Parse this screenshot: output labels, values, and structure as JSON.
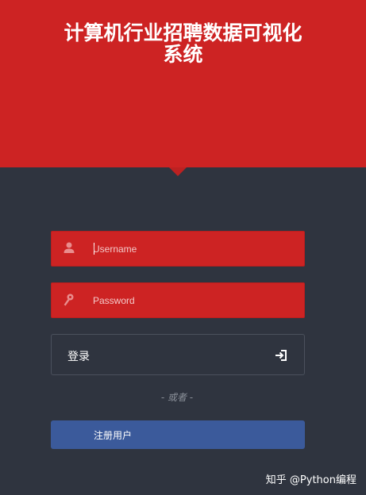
{
  "header": {
    "title_line1": "计算机行业招聘数据可视化",
    "title_line2": "系统",
    "color": "#cd2323"
  },
  "form": {
    "username": {
      "placeholder": "Username",
      "value": "",
      "icon": "user-icon"
    },
    "password": {
      "placeholder": "Password",
      "value": "",
      "icon": "key-icon"
    },
    "login_label": "登录",
    "login_icon": "sign-in-icon",
    "separator": "- 或者 -",
    "register_label": "注册用户"
  },
  "watermark": "知乎 @Python编程",
  "colors": {
    "background": "#2f343f",
    "accent": "#cd2323",
    "register": "#3b5a9b"
  }
}
